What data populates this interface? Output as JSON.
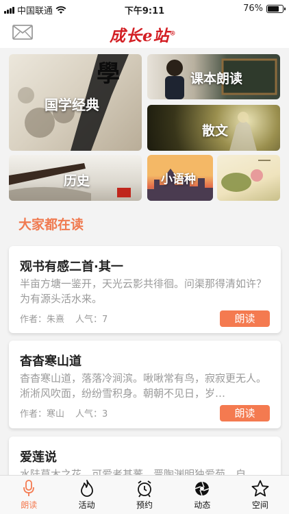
{
  "status_bar": {
    "carrier": "中国联通",
    "time": "下午9:11",
    "battery": "76%",
    "battery_level": 0.76
  },
  "header": {
    "logo_text": "成长e站",
    "logo_mark": "®"
  },
  "categories": [
    {
      "label": "国学经典"
    },
    {
      "label": "课本朗读"
    },
    {
      "label": "散文"
    },
    {
      "label": "历史"
    },
    {
      "label": "小语种"
    },
    {
      "label": ""
    }
  ],
  "section_title": "大家都在读",
  "cards": [
    {
      "title": "观书有感二首·其一",
      "excerpt": "半亩方塘一鉴开，天光云影共徘徊。问渠那得清如许？为有源头活水来。",
      "author": "作者：朱熹",
      "popularity": "人气：7",
      "button": "朗读"
    },
    {
      "title": "杳杳寒山道",
      "excerpt": "杳杳寒山道，落落冷涧滨。啾啾常有鸟，寂寂更无人。淅淅风吹面，纷纷雪积身。朝朝不见日，岁…",
      "author": "作者：寒山",
      "popularity": "人气：3",
      "button": "朗读"
    },
    {
      "title": "爱莲说",
      "excerpt": "水陆草木之花，可爱者甚蕃。晋陶渊明独爱菊。自",
      "author": "",
      "popularity": "",
      "button": ""
    }
  ],
  "tabs": [
    {
      "label": "朗读",
      "icon": "microphone-icon"
    },
    {
      "label": "活动",
      "icon": "fire-icon"
    },
    {
      "label": "预约",
      "icon": "alarm-clock-icon"
    },
    {
      "label": "动态",
      "icon": "camera-shutter-icon"
    },
    {
      "label": "空间",
      "icon": "star-icon"
    }
  ],
  "colors": {
    "accent": "#f47a50",
    "logo": "#d31f24"
  }
}
